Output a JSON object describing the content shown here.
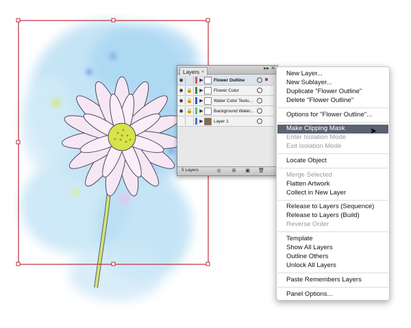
{
  "layers_panel": {
    "tab_label": "Layers",
    "tab_close": "×",
    "layers": [
      {
        "name": "Flower Outline",
        "color": "#d9534f",
        "selected": true,
        "locked": false
      },
      {
        "name": "Flower Color",
        "color": "#2e8b3a",
        "selected": false,
        "locked": true
      },
      {
        "name": "Water Color Textu...",
        "color": "#2f56d6",
        "selected": false,
        "locked": true
      },
      {
        "name": "Background Water...",
        "color": "#55c46a",
        "selected": false,
        "locked": true
      },
      {
        "name": "Layer 1",
        "color": "#3f6fe0",
        "selected": false,
        "locked": false
      }
    ],
    "layer_count": "5 Layers"
  },
  "context_menu": {
    "items": [
      {
        "label": "New Layer...",
        "enabled": true
      },
      {
        "label": "New Sublayer...",
        "enabled": true
      },
      {
        "label": "Duplicate \"Flower Outline\"",
        "enabled": true
      },
      {
        "label": "Delete \"Flower Outline\"",
        "enabled": true
      },
      {
        "label": "Options for \"Flower Outline\"...",
        "enabled": true
      },
      {
        "label": "Make Clipping Mask",
        "enabled": true,
        "highlighted": true
      },
      {
        "label": "Enter Isolation Mode",
        "enabled": false
      },
      {
        "label": "Exit Isolation Mode",
        "enabled": false
      },
      {
        "label": "Locate Object",
        "enabled": true
      },
      {
        "label": "Merge Selected",
        "enabled": false
      },
      {
        "label": "Flatten Artwork",
        "enabled": true
      },
      {
        "label": "Collect in New Layer",
        "enabled": true
      },
      {
        "label": "Release to Layers (Sequence)",
        "enabled": true
      },
      {
        "label": "Release to Layers (Build)",
        "enabled": true
      },
      {
        "label": "Reverse Order",
        "enabled": false
      },
      {
        "label": "Template",
        "enabled": true
      },
      {
        "label": "Show All Layers",
        "enabled": true
      },
      {
        "label": "Outline Others",
        "enabled": true
      },
      {
        "label": "Unlock All Layers",
        "enabled": true
      },
      {
        "label": "Paste Remembers Layers",
        "enabled": true
      },
      {
        "label": "Panel Options...",
        "enabled": true
      }
    ]
  },
  "colors": {
    "artboard_selection": "#c0283a",
    "menu_highlight": "#5b6270",
    "stem": "#d7e07a",
    "flower_center": "#d8e24a",
    "petal_tint": "#f3d6ee",
    "watercolor": "#9fd0ef"
  },
  "icons": {
    "eye": "eye-icon",
    "lock": "lock-icon",
    "disclosure": "triangle-right-icon",
    "target": "target-circle-icon",
    "panel_menu": "panel-menu-icon",
    "cursor": "arrow-cursor-icon"
  }
}
